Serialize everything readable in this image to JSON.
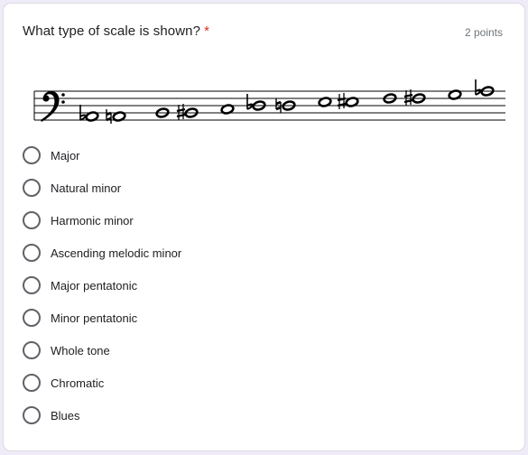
{
  "question": {
    "title": "What type of scale is shown?",
    "required_mark": "*",
    "points": "2 points"
  },
  "colors": {
    "background": "#f0ebf8",
    "card": "#ffffff",
    "required": "#d93025",
    "radio_border": "#5f6368"
  },
  "notation": {
    "clef": "bass-clef",
    "notes": [
      "B♭",
      "B♮",
      "C",
      "C♯",
      "D",
      "E♭",
      "E♮",
      "F",
      "F♯",
      "G",
      "G♯",
      "A",
      "B♭"
    ]
  },
  "options": [
    {
      "label": "Major"
    },
    {
      "label": "Natural minor"
    },
    {
      "label": "Harmonic minor"
    },
    {
      "label": "Ascending melodic minor"
    },
    {
      "label": "Major pentatonic"
    },
    {
      "label": "Minor pentatonic"
    },
    {
      "label": "Whole tone"
    },
    {
      "label": "Chromatic"
    },
    {
      "label": "Blues"
    }
  ]
}
